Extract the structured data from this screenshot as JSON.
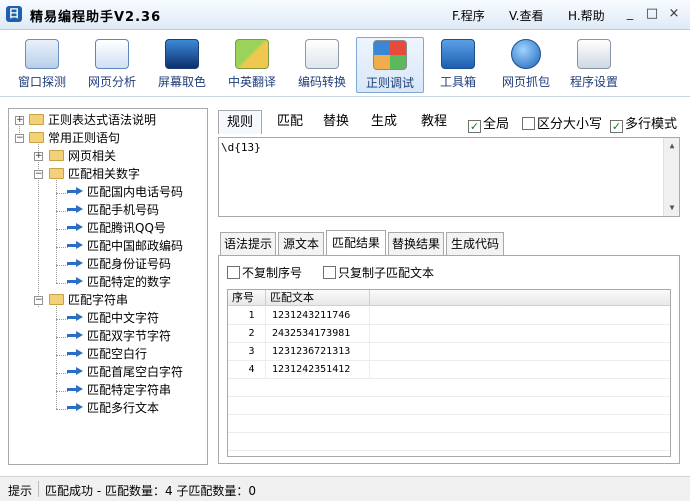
{
  "window": {
    "title": "精易编程助手V2.36",
    "menu": [
      "F.程序",
      "V.查看",
      "H.帮助"
    ],
    "controls": [
      "_",
      "□",
      "×"
    ]
  },
  "toolbar": {
    "items": [
      {
        "label": "窗口探测",
        "icon": "window-probe-icon"
      },
      {
        "label": "网页分析",
        "icon": "webpage-analysis-icon"
      },
      {
        "label": "屏幕取色",
        "icon": "screen-color-picker-icon"
      },
      {
        "label": "中英翻译",
        "icon": "translate-icon"
      },
      {
        "label": "编码转换",
        "icon": "encoding-convert-icon"
      },
      {
        "label": "正则调试",
        "icon": "regex-debug-icon"
      },
      {
        "label": "工具箱",
        "icon": "toolbox-icon"
      },
      {
        "label": "网页抓包",
        "icon": "packet-capture-icon"
      },
      {
        "label": "程序设置",
        "icon": "settings-icon"
      }
    ],
    "active": "正则调试"
  },
  "tree": {
    "nodes": [
      {
        "label": "正则表达式语法说明",
        "type": "folder",
        "expander": "+"
      },
      {
        "label": "常用正则语句",
        "type": "folder",
        "expander": "−"
      },
      {
        "label": "网页相关",
        "type": "folder",
        "expander": "+"
      },
      {
        "label": "匹配相关数字",
        "type": "folder",
        "expander": "−"
      },
      {
        "label": "匹配国内电话号码",
        "type": "leaf"
      },
      {
        "label": "匹配手机号码",
        "type": "leaf"
      },
      {
        "label": "匹配腾讯QQ号",
        "type": "leaf"
      },
      {
        "label": "匹配中国邮政编码",
        "type": "leaf"
      },
      {
        "label": "匹配身份证号码",
        "type": "leaf"
      },
      {
        "label": "匹配特定的数字",
        "type": "leaf"
      },
      {
        "label": "匹配字符串",
        "type": "folder",
        "expander": "−"
      },
      {
        "label": "匹配中文字符",
        "type": "leaf"
      },
      {
        "label": "匹配双字节字符",
        "type": "leaf"
      },
      {
        "label": "匹配空白行",
        "type": "leaf"
      },
      {
        "label": "匹配首尾空白字符",
        "type": "leaf"
      },
      {
        "label": "匹配特定字符串",
        "type": "leaf"
      },
      {
        "label": "匹配多行文本",
        "type": "leaf"
      }
    ]
  },
  "regex_panel": {
    "tabs": [
      "规则",
      "匹配",
      "替换",
      "生成",
      "教程"
    ],
    "active_tab": "规则",
    "options": [
      {
        "label": "全局",
        "checked": true
      },
      {
        "label": "区分大小写",
        "checked": false
      },
      {
        "label": "多行模式",
        "checked": true
      }
    ],
    "pattern": "\\d{13}"
  },
  "result_panel": {
    "tabs": [
      "语法提示",
      "源文本",
      "匹配结果",
      "替换结果",
      "生成代码"
    ],
    "active_tab": "匹配结果",
    "options": [
      {
        "label": "不复制序号",
        "checked": false
      },
      {
        "label": "只复制子匹配文本",
        "checked": false
      }
    ],
    "columns": [
      "序号",
      "匹配文本"
    ],
    "rows": [
      [
        "1",
        "1231243211746"
      ],
      [
        "2",
        "2432534173981"
      ],
      [
        "3",
        "1231236721313"
      ],
      [
        "4",
        "1231242351412"
      ]
    ]
  },
  "status": {
    "label": "提示",
    "message": "匹配成功 - 匹配数量：4   子匹配数量：0"
  },
  "colors": {
    "accent": "#1f3d79",
    "folder": "#f3d07a",
    "arrow": "#2b6fc4",
    "check": "#1a7a1a"
  }
}
